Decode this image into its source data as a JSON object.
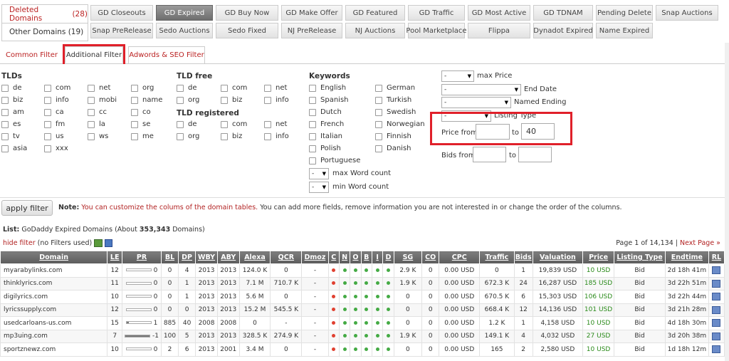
{
  "left_tabs": {
    "deleted": {
      "label": "Deleted Domains",
      "count": "(28)"
    },
    "other": {
      "label": "Other Domains (19)"
    }
  },
  "row1_tabs": [
    "GD Closeouts",
    "GD Expired",
    "GD Buy Now",
    "GD Make Offer",
    "GD Featured",
    "GD Traffic",
    "GD Most Active",
    "GD TDNAM",
    "Pending Delete",
    "Snap Auctions"
  ],
  "row2_tabs": [
    "Snap PreRelease",
    "Sedo Auctions",
    "Sedo Fixed",
    "NJ PreRelease",
    "NJ Auctions",
    "Pool Marketplace",
    "Flippa",
    "Dynadot Expired",
    "Name Expired"
  ],
  "filter_tabs": [
    "Common Filter",
    "Additional Filter",
    "Adwords & SEO Filter"
  ],
  "tlds": {
    "title": "TLDs",
    "items": [
      "de",
      "com",
      "net",
      "org",
      "biz",
      "info",
      "mobi",
      "name",
      "am",
      "ca",
      "cc",
      "co",
      "es",
      "fm",
      "la",
      "se",
      "tv",
      "us",
      "ws",
      "me",
      "asia",
      "xxx"
    ]
  },
  "tld_free": {
    "title": "TLD free",
    "items": [
      "de",
      "com",
      "net",
      "org",
      "biz",
      "info"
    ]
  },
  "tld_registered": {
    "title": "TLD registered",
    "items": [
      "de",
      "com",
      "net",
      "org",
      "biz",
      "info"
    ]
  },
  "keywords": {
    "title": "Keywords",
    "col1": [
      "English",
      "Spanish",
      "Dutch",
      "French",
      "Italian",
      "Polish",
      "Portuguese"
    ],
    "col2": [
      "German",
      "Turkish",
      "Swedish",
      "Norwegian",
      "Finnish",
      "Danish"
    ]
  },
  "word_count": {
    "max_label": "max Word count",
    "min_label": "min Word count",
    "value": "-"
  },
  "right_filters": {
    "max_price": {
      "value": "-",
      "label": "max Price"
    },
    "end_date": {
      "value": "-",
      "label": "End Date"
    },
    "named_ending": {
      "value": "-",
      "label": "Named Ending"
    },
    "listing_type": {
      "value": "-",
      "label": "Listing Type"
    },
    "price_from_label": "Price from",
    "price_from": "",
    "to_label": "to",
    "price_to": "40",
    "bids_from_label": "Bids from",
    "bids_from": "",
    "bids_to": ""
  },
  "apply_button": "apply filter",
  "note": {
    "label": "Note:",
    "red": "You can customize the colums of the domain tables.",
    "rest": "You can add more fields, remove information you are not interested in or change the order of the columns."
  },
  "list": {
    "label": "List:",
    "name": "GoDaddy Expired Domains (About",
    "count": "353,343",
    "suffix": "Domains)"
  },
  "hide_filter": "hide filter",
  "no_filters": "(no Filters used)",
  "pagination": {
    "page": "Page 1 of 14,134",
    "sep": "|",
    "next": "Next Page »"
  },
  "colors": {
    "accent_red": "#e0202a",
    "link_red": "#b22222",
    "green": "#2a8a1a"
  },
  "table": {
    "headers": [
      "Domain",
      "LE",
      "PR",
      "BL",
      "DP",
      "WBY",
      "ABY",
      "Alexa",
      "QCR",
      "Dmoz",
      "C",
      "N",
      "O",
      "B",
      "I",
      "D",
      "SG",
      "CO",
      "CPC",
      "Traffic",
      "Bids",
      "Valuation",
      "Price",
      "Listing Type",
      "Endtime",
      "RL"
    ],
    "rows": [
      {
        "domain": "myarabylinks.com",
        "le": "12",
        "pr": "0",
        "pr_fill": 0,
        "bl": "0",
        "dp": "4",
        "wby": "2013",
        "aby": "2013",
        "alexa": "124.0 K",
        "qcr": "0",
        "dmoz": "-",
        "c": "red",
        "n": "green",
        "o": "green",
        "b": "green",
        "i": "green",
        "d": "green",
        "sg": "2.9 K",
        "co": "0",
        "cpc": "0.00 USD",
        "traffic": "0",
        "bids": "1",
        "valuation": "19,839 USD",
        "price": "10 USD",
        "listing": "Bid",
        "end": "2d 18h 41m"
      },
      {
        "domain": "thinklyrics.com",
        "le": "11",
        "pr": "0",
        "pr_fill": 0,
        "bl": "0",
        "dp": "1",
        "wby": "2013",
        "aby": "2013",
        "alexa": "7.1 M",
        "qcr": "710.7 K",
        "dmoz": "-",
        "c": "red",
        "n": "green",
        "o": "green",
        "b": "green",
        "i": "green",
        "d": "green",
        "sg": "1.9 K",
        "co": "0",
        "cpc": "0.00 USD",
        "traffic": "672.3 K",
        "bids": "24",
        "valuation": "16,287 USD",
        "price": "185 USD",
        "listing": "Bid",
        "end": "3d 22h 51m"
      },
      {
        "domain": "digilyrics.com",
        "le": "10",
        "pr": "0",
        "pr_fill": 0,
        "bl": "0",
        "dp": "1",
        "wby": "2013",
        "aby": "2013",
        "alexa": "5.6 M",
        "qcr": "0",
        "dmoz": "-",
        "c": "red",
        "n": "green",
        "o": "green",
        "b": "green",
        "i": "green",
        "d": "green",
        "sg": "0",
        "co": "0",
        "cpc": "0.00 USD",
        "traffic": "670.5 K",
        "bids": "6",
        "valuation": "15,303 USD",
        "price": "106 USD",
        "listing": "Bid",
        "end": "3d 22h 44m"
      },
      {
        "domain": "lyricssupply.com",
        "le": "12",
        "pr": "0",
        "pr_fill": 0,
        "bl": "0",
        "dp": "0",
        "wby": "2013",
        "aby": "2013",
        "alexa": "15.2 M",
        "qcr": "545.5 K",
        "dmoz": "-",
        "c": "red",
        "n": "green",
        "o": "green",
        "b": "green",
        "i": "green",
        "d": "green",
        "sg": "0",
        "co": "0",
        "cpc": "0.00 USD",
        "traffic": "668.4 K",
        "bids": "12",
        "valuation": "14,136 USD",
        "price": "101 USD",
        "listing": "Bid",
        "end": "3d 21h 28m"
      },
      {
        "domain": "usedcarloans-us.com",
        "le": "15",
        "pr": "1",
        "pr_fill": 0.1,
        "bl": "885",
        "dp": "40",
        "wby": "2008",
        "aby": "2008",
        "alexa": "0",
        "qcr": "-",
        "dmoz": "-",
        "c": "red",
        "n": "green",
        "o": "green",
        "b": "green",
        "i": "green",
        "d": "green",
        "sg": "0",
        "co": "0",
        "cpc": "0.00 USD",
        "traffic": "1.2 K",
        "bids": "1",
        "valuation": "4,158 USD",
        "price": "10 USD",
        "listing": "Bid",
        "end": "4d 18h 30m"
      },
      {
        "domain": "mp3uing.com",
        "le": "7",
        "pr": "-1",
        "pr_fill": 1,
        "bl": "100",
        "dp": "5",
        "wby": "2013",
        "aby": "2013",
        "alexa": "328.5 K",
        "qcr": "274.9 K",
        "dmoz": "-",
        "c": "red",
        "n": "green",
        "o": "green",
        "b": "green",
        "i": "green",
        "d": "green",
        "sg": "1.9 K",
        "co": "0",
        "cpc": "0.00 USD",
        "traffic": "149.1 K",
        "bids": "4",
        "valuation": "4,032 USD",
        "price": "27 USD",
        "listing": "Bid",
        "end": "3d 20h 38m"
      },
      {
        "domain": "sportznewz.com",
        "le": "10",
        "pr": "0",
        "pr_fill": 0,
        "bl": "2",
        "dp": "6",
        "wby": "2013",
        "aby": "2001",
        "alexa": "3.4 M",
        "qcr": "0",
        "dmoz": "-",
        "c": "red",
        "n": "green",
        "o": "green",
        "b": "green",
        "i": "green",
        "d": "green",
        "sg": "0",
        "co": "0",
        "cpc": "0.00 USD",
        "traffic": "165",
        "bids": "2",
        "valuation": "2,580 USD",
        "price": "10 USD",
        "listing": "Bid",
        "end": "1d 18h 12m"
      }
    ]
  }
}
